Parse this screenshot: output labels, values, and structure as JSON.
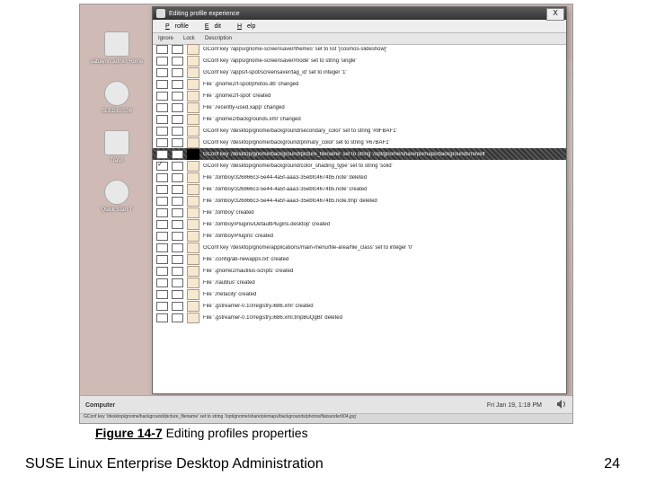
{
  "figure": {
    "label": "Figure 14-7",
    "title": "Editing profiles properties"
  },
  "footer": {
    "text": "SUSE Linux Enterprise Desktop Administration",
    "page": "24"
  },
  "desktop": {
    "icons": [
      "sabayon-admin Home",
      "SLED100.06",
      "Trash",
      "Quick Start T"
    ],
    "computer": "Computer",
    "clock": "Fri Jan 19,   1:18 PM",
    "statusline": "GConf key '/desktop/gnome/background/picture_filename' set to string '/opt/gnome/share/pixmaps/backgrounds/photos/flatsunder004.jpg'"
  },
  "window": {
    "title": "Editing profile experience",
    "menu": [
      "Profile",
      "Edit",
      "Help"
    ],
    "headers": {
      "ignore": "Ignore",
      "lock": "Lock",
      "desc": "Description"
    },
    "rows": [
      {
        "d": "GConf key '/apps/gnome-screensaver/themes' set to list '[cosmos-slideshow]'"
      },
      {
        "d": "GConf key '/apps/gnome-screensaver/mode' set to string 'single'"
      },
      {
        "d": "GConf key '/apps/f-spot/screensaver/tag_id' set to integer '1'"
      },
      {
        "d": "File '.gnome2/f-spot/photos.db' changed"
      },
      {
        "d": "File '.gnome2/f-spot' created"
      },
      {
        "d": "File '.recently-used.xapp' changed"
      },
      {
        "d": "File '.gnome2/backgrounds.xml' changed"
      },
      {
        "d": "GConf key '/desktop/gnome/background/secondary_color' set to string '#9FBAF1'"
      },
      {
        "d": "GConf key '/desktop/gnome/background/primary_color' set to string '#67BAF1'"
      },
      {
        "sel": true,
        "d": "GConf key '/desktop/gnome/background/picture_filename' set to string '/opt/gnome/share/pixmaps/backgrounds/novell'"
      },
      {
        "ck": true,
        "d": "GConf key '/desktop/gnome/background/color_shading_type' set to string 'solid'"
      },
      {
        "d": "File '.tomboy/326866c3-5e44-4a5f-aaa3-35ebfc4674b5.note' deleted"
      },
      {
        "d": "File '.tomboy/326866c3-5e44-4a5f-aaa3-35ebfc4674b5.note' created"
      },
      {
        "d": "File '.tomboy/326866c3-5e44-4a5f-aaa3-35ebfc4674b5.note.tmp' deleted"
      },
      {
        "d": "File '.tomboy' created"
      },
      {
        "d": "File '.tomboy/Plugins/DefaultPlugins.desktop' created"
      },
      {
        "d": "File '.tomboy/Plugins' created"
      },
      {
        "d": "GConf key '/desktop/gnome/applications/main-menu/file-area/file_class' set to integer '0'"
      },
      {
        "d": "File '.config/ab-newapps.txt' created"
      },
      {
        "d": "File '.gnome2/nautilus-scripts' created"
      },
      {
        "d": "File '.nautilus' created"
      },
      {
        "d": "File '.metacity' created"
      },
      {
        "d": "File '.gstreamer-0.10/registry.i686.xml' created"
      },
      {
        "d": "File '.gstreamer-0.10/registry.i686.xml.tmpBuQgBI' deleted"
      }
    ]
  }
}
